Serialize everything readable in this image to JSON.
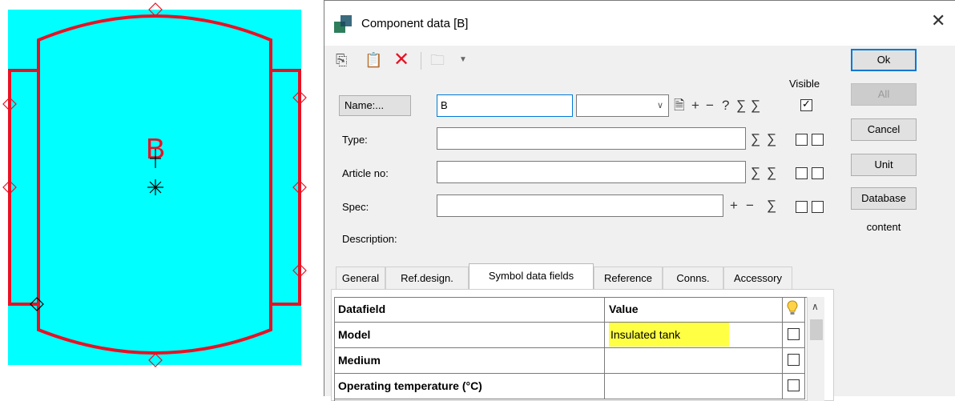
{
  "drawing": {
    "component_label": "B",
    "colors": {
      "fill": "#00ffff",
      "outline": "#e81123"
    }
  },
  "dialog": {
    "title": "Component data [B]",
    "close_symbol": "✕"
  },
  "toolbar": {
    "icons": [
      "copy-icon",
      "paste-icon",
      "delete-icon",
      "folder-icon",
      "chevron-down-icon"
    ]
  },
  "buttons": {
    "ok": "Ok",
    "all": "All",
    "cancel": "Cancel",
    "unit": "Unit",
    "database": "Database",
    "database_content": "content"
  },
  "form": {
    "name_button": "Name:...",
    "name_value": "B",
    "name_select_value": "",
    "visible_label": "Visible",
    "visible_checked": true,
    "type_label": "Type:",
    "type_value": "",
    "article_label": "Article no:",
    "article_value": "",
    "spec_label": "Spec:",
    "spec_value": "",
    "description_label": "Description:"
  },
  "tabs": [
    {
      "label": "General",
      "active": false
    },
    {
      "label": "Ref.design.",
      "active": false
    },
    {
      "label": "Symbol data fields",
      "active": true
    },
    {
      "label": "Reference",
      "active": false
    },
    {
      "label": "Conns.",
      "active": false
    },
    {
      "label": "Accessory",
      "active": false
    }
  ],
  "grid": {
    "headers": [
      "Datafield",
      "Value"
    ],
    "rows": [
      {
        "field": "Model",
        "value": "Insulated tank",
        "highlight": true,
        "checked": false
      },
      {
        "field": "Medium",
        "value": "",
        "highlight": false,
        "checked": false
      },
      {
        "field": "Operating temperature (°C)",
        "value": "",
        "highlight": false,
        "checked": false
      }
    ]
  }
}
